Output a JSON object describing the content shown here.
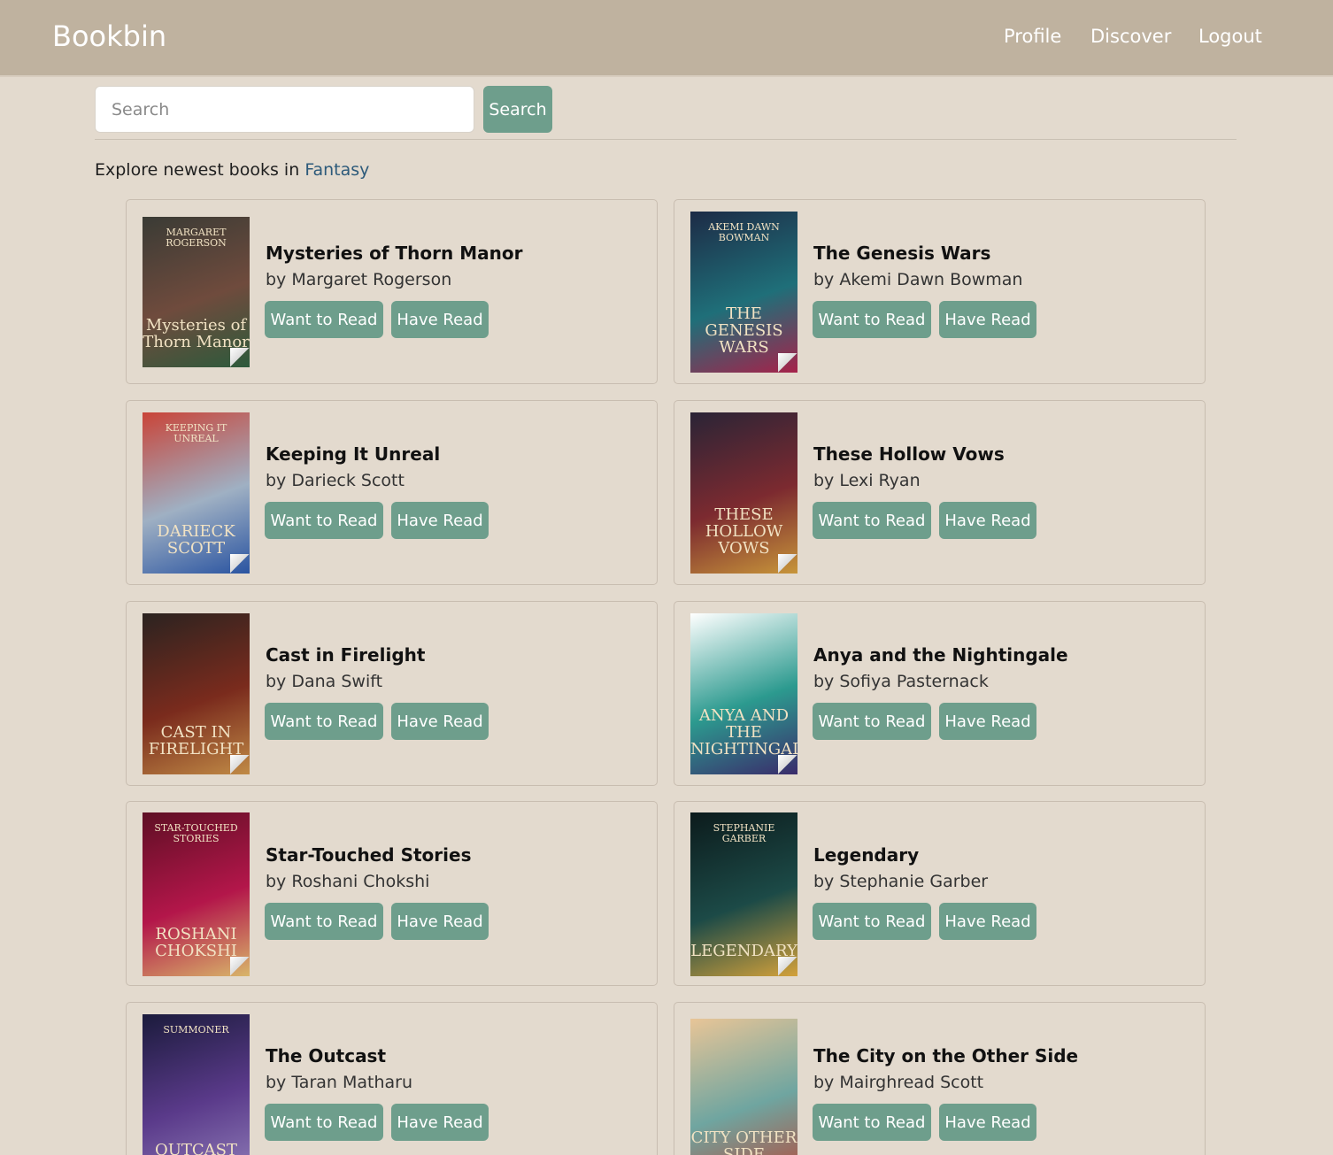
{
  "nav": {
    "brand": "Bookbin",
    "links": [
      "Profile",
      "Discover",
      "Logout"
    ]
  },
  "search": {
    "placeholder": "Search",
    "button_label": "Search"
  },
  "explore": {
    "prefix": "Explore newest books in",
    "genre": "Fantasy"
  },
  "buttons": {
    "want_to_read": "Want to Read",
    "have_read": "Have Read"
  },
  "books": [
    {
      "title": "Mysteries of Thorn Manor",
      "author": "by Margaret Rogerson",
      "cover_colors": [
        "#3a3b35",
        "#6f4b3d",
        "#2d5a3c"
      ]
    },
    {
      "title": "The Genesis Wars",
      "author": "by Akemi Dawn Bowman",
      "cover_colors": [
        "#1d2b46",
        "#1f6f79",
        "#a6224a"
      ]
    },
    {
      "title": "Keeping It Unreal",
      "author": "by Darieck Scott",
      "cover_colors": [
        "#c94438",
        "#9fb0c3",
        "#2a54a1"
      ]
    },
    {
      "title": "These Hollow Vows",
      "author": "by Lexi Ryan",
      "cover_colors": [
        "#2a2436",
        "#7c2a30",
        "#c7953a"
      ]
    },
    {
      "title": "Cast in Firelight",
      "author": "by Dana Swift",
      "cover_colors": [
        "#2b2320",
        "#7a2b1d",
        "#c08a46"
      ]
    },
    {
      "title": "Anya and the Nightingale",
      "author": "by Sofiya Pasternack",
      "cover_colors": [
        "#ffffff",
        "#2c9a8f",
        "#3a2b6b"
      ]
    },
    {
      "title": "Star-Touched Stories",
      "author": "by Roshani Chokshi",
      "cover_colors": [
        "#5e0f24",
        "#b3164a",
        "#d8b56a"
      ]
    },
    {
      "title": "Legendary",
      "author": "by Stephanie Garber",
      "cover_colors": [
        "#0c1b1c",
        "#1c4a47",
        "#d3a13b"
      ]
    },
    {
      "title": "The Outcast",
      "author": "by Taran Matharu",
      "cover_colors": [
        "#1b1b3c",
        "#5a3a8a",
        "#8d7ab6"
      ]
    },
    {
      "title": "The City on the Other Side",
      "author": "by Mairghread Scott",
      "cover_colors": [
        "#e8c597",
        "#6fa5a0",
        "#b24e3e"
      ]
    }
  ],
  "covers": [
    {
      "author": "MARGARET ROGERSON",
      "title": "Mysteries of Thorn Manor"
    },
    {
      "author": "AKEMI DAWN BOWMAN",
      "title": "THE GENESIS WARS"
    },
    {
      "author": "KEEPING IT UNREAL",
      "title": "DARIECK SCOTT"
    },
    {
      "author": "",
      "title": "THESE HOLLOW VOWS"
    },
    {
      "author": "",
      "title": "CAST IN FIRELIGHT"
    },
    {
      "author": "",
      "title": "ANYA AND THE NIGHTINGALE"
    },
    {
      "author": "STAR-TOUCHED STORIES",
      "title": "ROSHANI CHOKSHI"
    },
    {
      "author": "STEPHANIE GARBER",
      "title": "LEGENDARY"
    },
    {
      "author": "SUMMONER",
      "title": "OUTCAST"
    },
    {
      "author": "",
      "title": "CITY OTHER SIDE"
    }
  ]
}
